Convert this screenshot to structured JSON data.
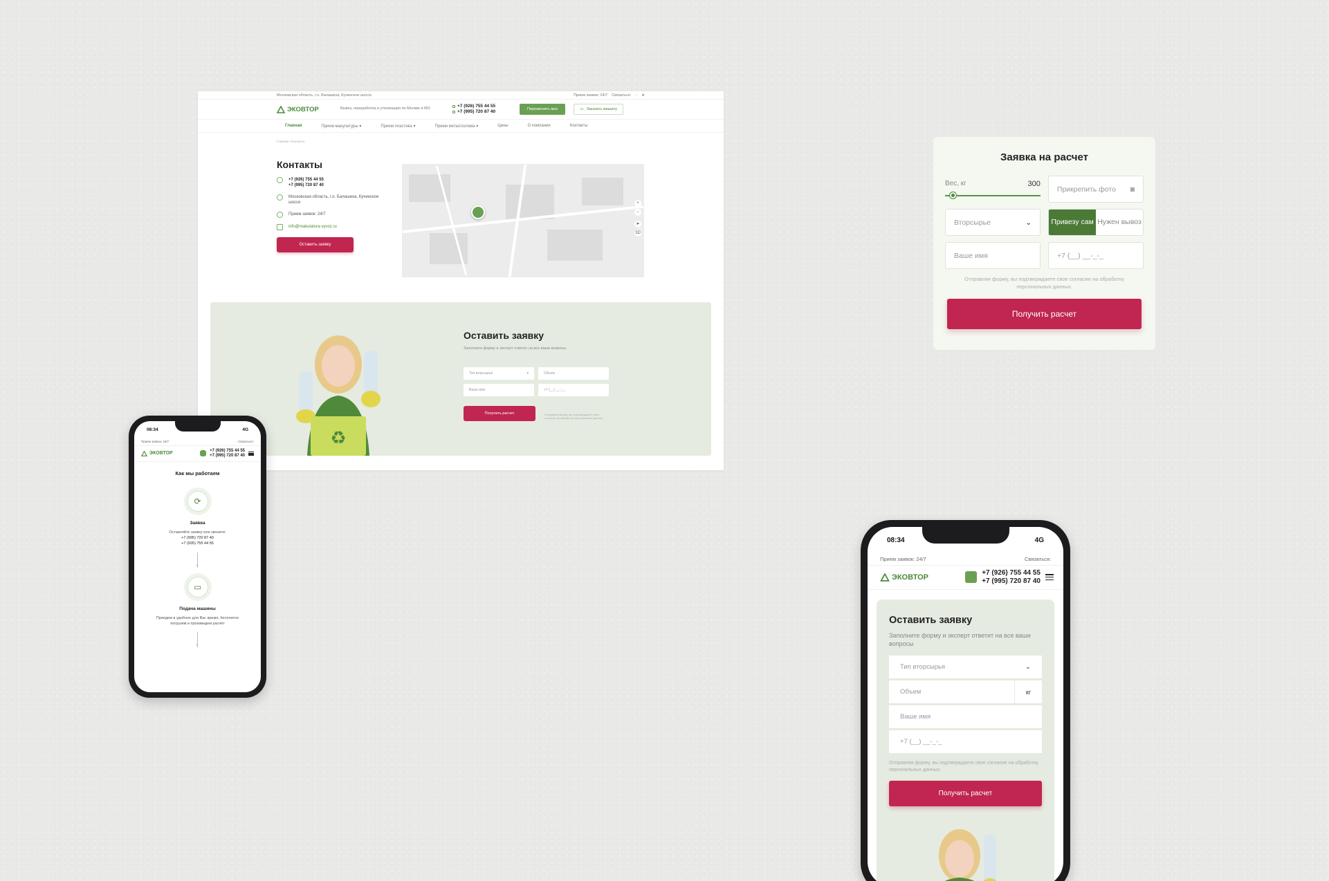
{
  "brand": {
    "name": "ЭКОВТОР",
    "color": "#4b8a38",
    "accent": "#c0264f"
  },
  "desktop": {
    "address": "Московская область, г.о. Балашиха, Кучинское шоссе",
    "hours": "Прием заявок: 24/7",
    "connect": "Связаться:",
    "slogan": "Вывоз, переработка и утилизация по Москве и МО",
    "phone1": "+7 (926) 755 44 55",
    "phone2": "+7 (995) 720 87 40",
    "callback_btn": "Перезвонить мне",
    "order_car_btn": "Заказать машину",
    "nav": [
      "Главная",
      "Прием макулатуры",
      "Прием пластика",
      "Прием металлолома",
      "Цены",
      "О компании",
      "Контакты"
    ],
    "breadcrumbs": "Главная / Контакты",
    "contacts_title": "Контакты",
    "contacts": {
      "phone1": "+7 (926) 755 44 55",
      "phone2": "+7 (995) 720 87 40",
      "address": "Московская область, г.о. Балашиха, Кучинское шоссе",
      "hours": "Прием заявок: 24/7",
      "email": "info@makulatura-vyvoz.ru"
    },
    "leave_request_btn": "Оставить заявку",
    "order": {
      "title": "Оставить заявку",
      "subtitle": "Заполните форму и эксперт ответит на все ваши вопросы",
      "type_placeholder": "Тип вторсырья",
      "volume_placeholder": "Объем",
      "name_placeholder": "Ваше имя",
      "phone_placeholder": "+7 (__) __-_-_",
      "submit": "Получить расчет",
      "note": "Отправляя форму, вы подтверждаете свое согласие на обработку персональных данных"
    }
  },
  "calc": {
    "title": "Заявка на расчет",
    "weight_label": "Вес, кг",
    "weight_value": "300",
    "weight_fraction": 0.05,
    "attach_photo": "Прикрепить фото",
    "material": "Вторсырье",
    "toggle_self": "Привезу сам",
    "toggle_pickup": "Нужен вывоз",
    "name_placeholder": "Ваше имя",
    "phone_placeholder": "+7 (__) __-_-_",
    "consent": "Отправляя форму, вы подтверждаете свое согласие на обработку персональных данных.",
    "submit": "Получить расчет"
  },
  "phone_small": {
    "time": "08:34",
    "network": "4G",
    "hours": "Прием заявок: 24/7",
    "connect": "Связаться:",
    "phone1": "+7 (926) 755 44 55",
    "phone2": "+7 (995) 720 87 40",
    "section_title": "Как мы работаем",
    "step1_title": "Заявка",
    "step1_text": "Оставляйте заявку или звоните:",
    "step1_phone1": "+7 (995) 720 87 40",
    "step1_phone2": "+7 (926) 755 44 55",
    "step2_title": "Подача машины",
    "step2_text": "Приедем в удобное для Вас время, бесплатно погрузим и произведем расчёт"
  },
  "phone_large": {
    "time": "08:34",
    "network": "4G",
    "hours": "Прием заявок: 24/7",
    "connect": "Связаться:",
    "phone1": "+7 (926) 755 44 55",
    "phone2": "+7 (995) 720 87 40",
    "title": "Оставить заявку",
    "subtitle": "Заполните форму и эксперт ответит на все ваши вопросы",
    "type_placeholder": "Тип вторсырья",
    "volume_placeholder": "Объем",
    "volume_unit": "кг",
    "name_placeholder": "Ваше имя",
    "phone_placeholder": "+7 (__) __-_-_",
    "note": "Отправляя форму, вы подтверждаете свое согласие на обработку персональных данных.",
    "submit": "Получить расчет"
  }
}
